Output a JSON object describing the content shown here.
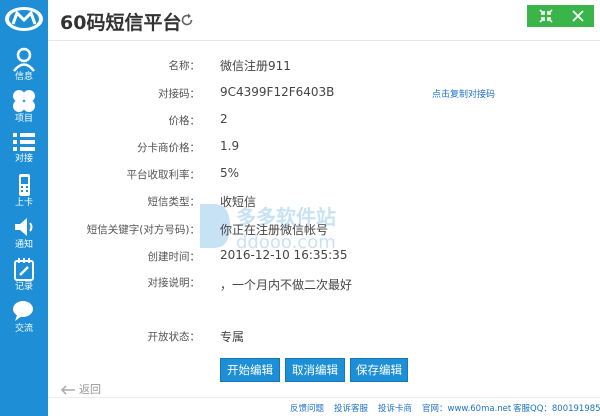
{
  "app": {
    "title": "60码短信平台"
  },
  "sidebar": {
    "items": [
      {
        "label": "信息"
      },
      {
        "label": "项目"
      },
      {
        "label": "对接"
      },
      {
        "label": "上卡"
      },
      {
        "label": "通知"
      },
      {
        "label": "记录"
      },
      {
        "label": "交流"
      }
    ]
  },
  "details": {
    "rows": [
      {
        "label": "名称：",
        "value": "微信注册911"
      },
      {
        "label": "对接码：",
        "value": "9C4399F12F6403B"
      },
      {
        "label": "价格：",
        "value": "2"
      },
      {
        "label": "分卡商价格：",
        "value": "1.9"
      },
      {
        "label": "平台收取利率：",
        "value": "5%"
      },
      {
        "label": "短信类型：",
        "value": "收短信"
      },
      {
        "label": "短信关键字(对方号码)：",
        "value": "你正在注册微信帐号"
      },
      {
        "label": "创建时间：",
        "value": "2016-12-10 16:35:35"
      },
      {
        "label": "对接说明：",
        "value": "，一个月内不做二次最好"
      },
      {
        "label": "开放状态：",
        "value": "专属"
      }
    ],
    "copy_link": "点击复制对接码"
  },
  "buttons": {
    "start": "开始编辑",
    "cancel": "取消编辑",
    "save": "保存编辑"
  },
  "back_label": "返回",
  "watermark": {
    "name": "多多软件站",
    "url": "ddooo.com"
  },
  "footer": {
    "feedback": "反馈问题",
    "complain_service": "投诉客服",
    "complain_card": "投诉卡商",
    "website": "官网：www.60ma.net",
    "qq": "客服QQ：800191985"
  },
  "colors": {
    "sidebar": "#1e8fd6",
    "button": "#1e8fd6",
    "window_controls": "#3ab54a",
    "link": "#1e73c9"
  }
}
